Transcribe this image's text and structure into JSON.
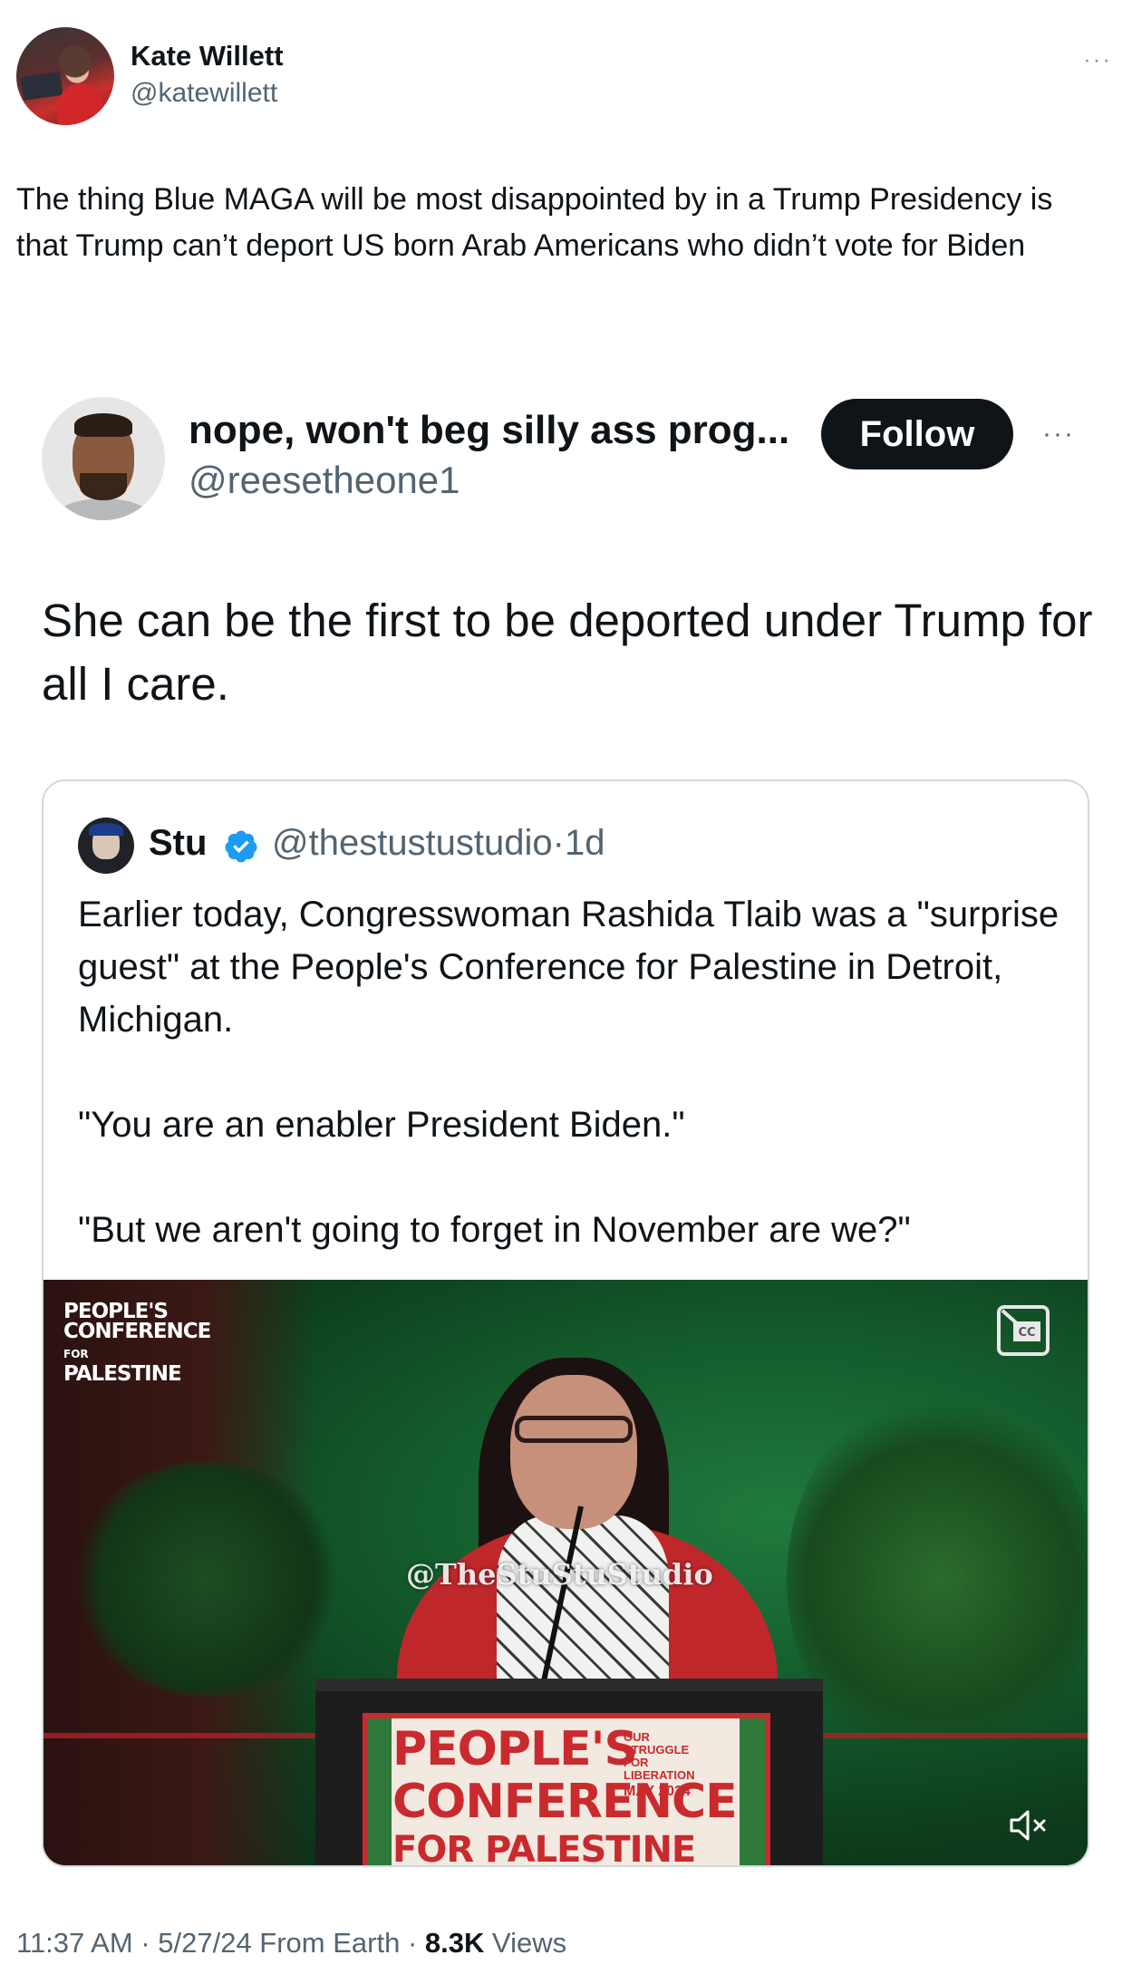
{
  "outer_tweet": {
    "author_name": "Kate Willett",
    "author_handle": "@katewillett",
    "more_label": "···",
    "text": "The thing Blue MAGA will be most disappointed by in a Trump Presidency is that Trump can’t deport US born Arab Americans who didn’t vote for Biden"
  },
  "reply_tweet": {
    "author_name": "nope, won't beg silly ass prog...",
    "author_handle": "@reesetheone1",
    "follow_label": "Follow",
    "more_label": "···",
    "text": "She can be the first to be deported under Trump for all I care."
  },
  "quoted_tweet": {
    "author_name": "Stu",
    "author_handle": "@thestustustudio",
    "separator": "·",
    "age": "1d",
    "paragraphs": [
      "Earlier today, Congresswoman Rashida Tlaib was a \"surprise guest\" at the People's Conference for Palestine in Detroit, Michigan.",
      "\"You are an enabler President Biden.\"",
      "\"But we aren't going to forget in November are we?\""
    ],
    "video": {
      "logo_line1": "PEOPLE'S",
      "logo_line2": "CONFERENCE",
      "logo_for": "FOR",
      "logo_line3": "PALESTINE",
      "watermark": "@TheStuStuStudio",
      "sign_line1": "PEOPLE'S",
      "sign_line2": "CONFERENCE",
      "sign_line3": "FOR PALESTINE",
      "sign_small_1": "OUR STRUGGLE",
      "sign_small_2": "FOR LIBERATION",
      "sign_small_3": "MAY 2024",
      "muted": true
    }
  },
  "footer": {
    "time": "11:37 AM",
    "sep1": " · ",
    "date": "5/27/24",
    "source": " From Earth",
    "sep2": " · ",
    "views_count": "8.3K",
    "views_label": " Views"
  },
  "colors": {
    "text_primary": "#0f1419",
    "text_secondary": "#536471",
    "follow_bg": "#0f1419",
    "verified_blue": "#1d9bf0",
    "card_border": "#cfd9de"
  }
}
